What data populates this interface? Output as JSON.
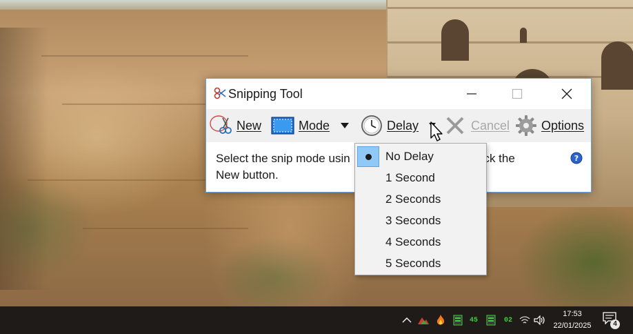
{
  "window": {
    "title": "Snipping Tool",
    "icon": "scissors-icon"
  },
  "toolbar": {
    "new_label": "New",
    "mode_label": "Mode",
    "delay_label": "Delay",
    "cancel_label": "Cancel",
    "options_label": "Options"
  },
  "content": {
    "message_line1": "Select the snip mode usin",
    "message_line1_tail": "ick the",
    "message_line2": "New button."
  },
  "delay_menu": {
    "selected": "No Delay",
    "items": [
      {
        "label": "No Delay",
        "checked": true
      },
      {
        "label": "1 Second",
        "checked": false
      },
      {
        "label": "2 Seconds",
        "checked": false
      },
      {
        "label": "3 Seconds",
        "checked": false
      },
      {
        "label": "4 Seconds",
        "checked": false
      },
      {
        "label": "5 Seconds",
        "checked": false
      }
    ]
  },
  "taskbar": {
    "tray_numbers": [
      "45",
      "02"
    ],
    "time": "17:53",
    "date": "22/01/2025",
    "notification_count": "4"
  },
  "colors": {
    "menu_check_bg": "#90c8f6",
    "taskbar_bg": "#1f1b18",
    "window_border": "#6f9ed3",
    "cancel_disabled": "#a8a8a8"
  }
}
